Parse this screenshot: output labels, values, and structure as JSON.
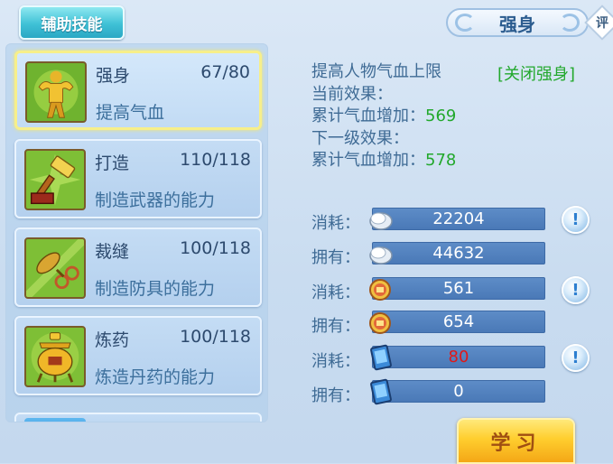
{
  "header": {
    "tab_label": "辅助技能",
    "title": "强身",
    "rate_label": "评"
  },
  "skills": [
    {
      "name": "强身",
      "level": "67/80",
      "desc": "提高气血",
      "icon": "strong-body-icon",
      "active": true
    },
    {
      "name": "打造",
      "level": "110/118",
      "desc": "制造武器的能力",
      "icon": "hammer-icon",
      "active": false
    },
    {
      "name": "裁缝",
      "level": "100/118",
      "desc": "制造防具的能力",
      "icon": "scissors-icon",
      "active": false
    },
    {
      "name": "炼药",
      "level": "100/118",
      "desc": "炼造丹药的能力",
      "icon": "cauldron-icon",
      "active": false
    }
  ],
  "detail": {
    "line1": "提高人物气血上限",
    "close_label": "[关闭强身]",
    "current_label": "当前效果：",
    "current_stat_label": "累计气血增加：",
    "current_stat_value": "569",
    "next_label": "下一级效果：",
    "next_stat_label": "累计气血增加：",
    "next_stat_value": "578"
  },
  "costs": [
    {
      "label": "消耗：",
      "value": "22204",
      "icon": "silver-coin-icon",
      "info": true,
      "red": false
    },
    {
      "label": "拥有：",
      "value": "44632",
      "icon": "silver-coin-icon",
      "info": false,
      "red": false
    },
    {
      "label": "消耗：",
      "value": "561",
      "icon": "contribution-token-icon",
      "info": true,
      "red": false
    },
    {
      "label": "拥有：",
      "value": "654",
      "icon": "contribution-token-icon",
      "info": false,
      "red": false
    },
    {
      "label": "消耗：",
      "value": "80",
      "icon": "energy-card-icon",
      "info": true,
      "red": true
    },
    {
      "label": "拥有：",
      "value": "0",
      "icon": "energy-card-icon",
      "info": false,
      "red": false
    }
  ],
  "info_symbol": "!",
  "learn_button": "学习",
  "colors": {
    "accent_green": "#22a82c",
    "warning_red": "#e01818",
    "active_border": "#f7ef8a",
    "learn_button": "#ffce2e"
  }
}
